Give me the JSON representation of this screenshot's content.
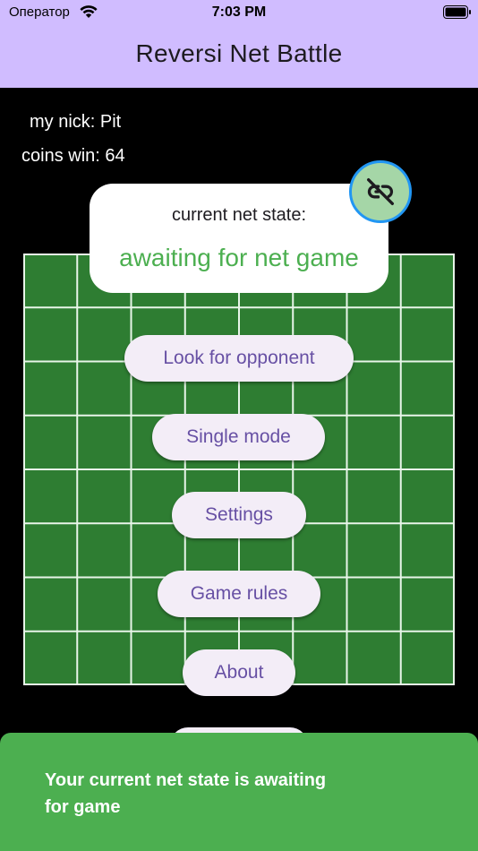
{
  "status_bar": {
    "carrier": "Оператор",
    "time": "7:03 PM"
  },
  "app_bar": {
    "title": "Reversi Net Battle"
  },
  "player": {
    "nick_text": "my nick: Pit",
    "coins_text": "coins win: 64"
  },
  "net_state": {
    "label": "current net state:",
    "value": "awaiting for net game",
    "icon": "link-off-icon"
  },
  "menu": {
    "look_for_opponent": "Look for opponent",
    "single_mode": "Single mode",
    "settings": "Settings",
    "game_rules": "Game rules",
    "about": "About"
  },
  "snackbar": {
    "message": "Your current net state is awaiting for game"
  },
  "colors": {
    "app_bar": "#d0bcff",
    "board": "#2e7d32",
    "button_bg": "#f3edf7",
    "button_text": "#6750a4",
    "state_value": "#4caf50",
    "snackbar": "#4caf50"
  }
}
